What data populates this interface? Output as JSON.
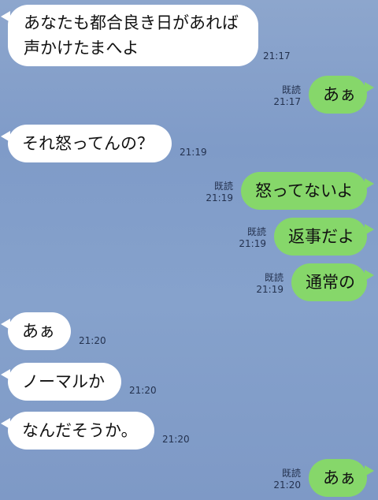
{
  "messages": [
    {
      "side": "in",
      "text": "あなたも都合良き日があれば声かけたまへよ",
      "time": "21:17"
    },
    {
      "side": "out",
      "text": "あぁ",
      "read": "既読",
      "time": "21:17"
    },
    {
      "side": "in",
      "text": "それ怒ってんの？",
      "time": "21:19"
    },
    {
      "side": "out",
      "text": "怒ってないよ",
      "read": "既読",
      "time": "21:19"
    },
    {
      "side": "out",
      "text": "返事だよ",
      "read": "既読",
      "time": "21:19"
    },
    {
      "side": "out",
      "text": "通常の",
      "read": "既読",
      "time": "21:19"
    },
    {
      "side": "in",
      "text": "あぁ",
      "time": "21:20"
    },
    {
      "side": "in",
      "text": "ノーマルか",
      "time": "21:20"
    },
    {
      "side": "in",
      "text": "なんだそうか。",
      "time": "21:20"
    },
    {
      "side": "out",
      "text": "あぁ",
      "read": "既読",
      "time": "21:20"
    }
  ]
}
